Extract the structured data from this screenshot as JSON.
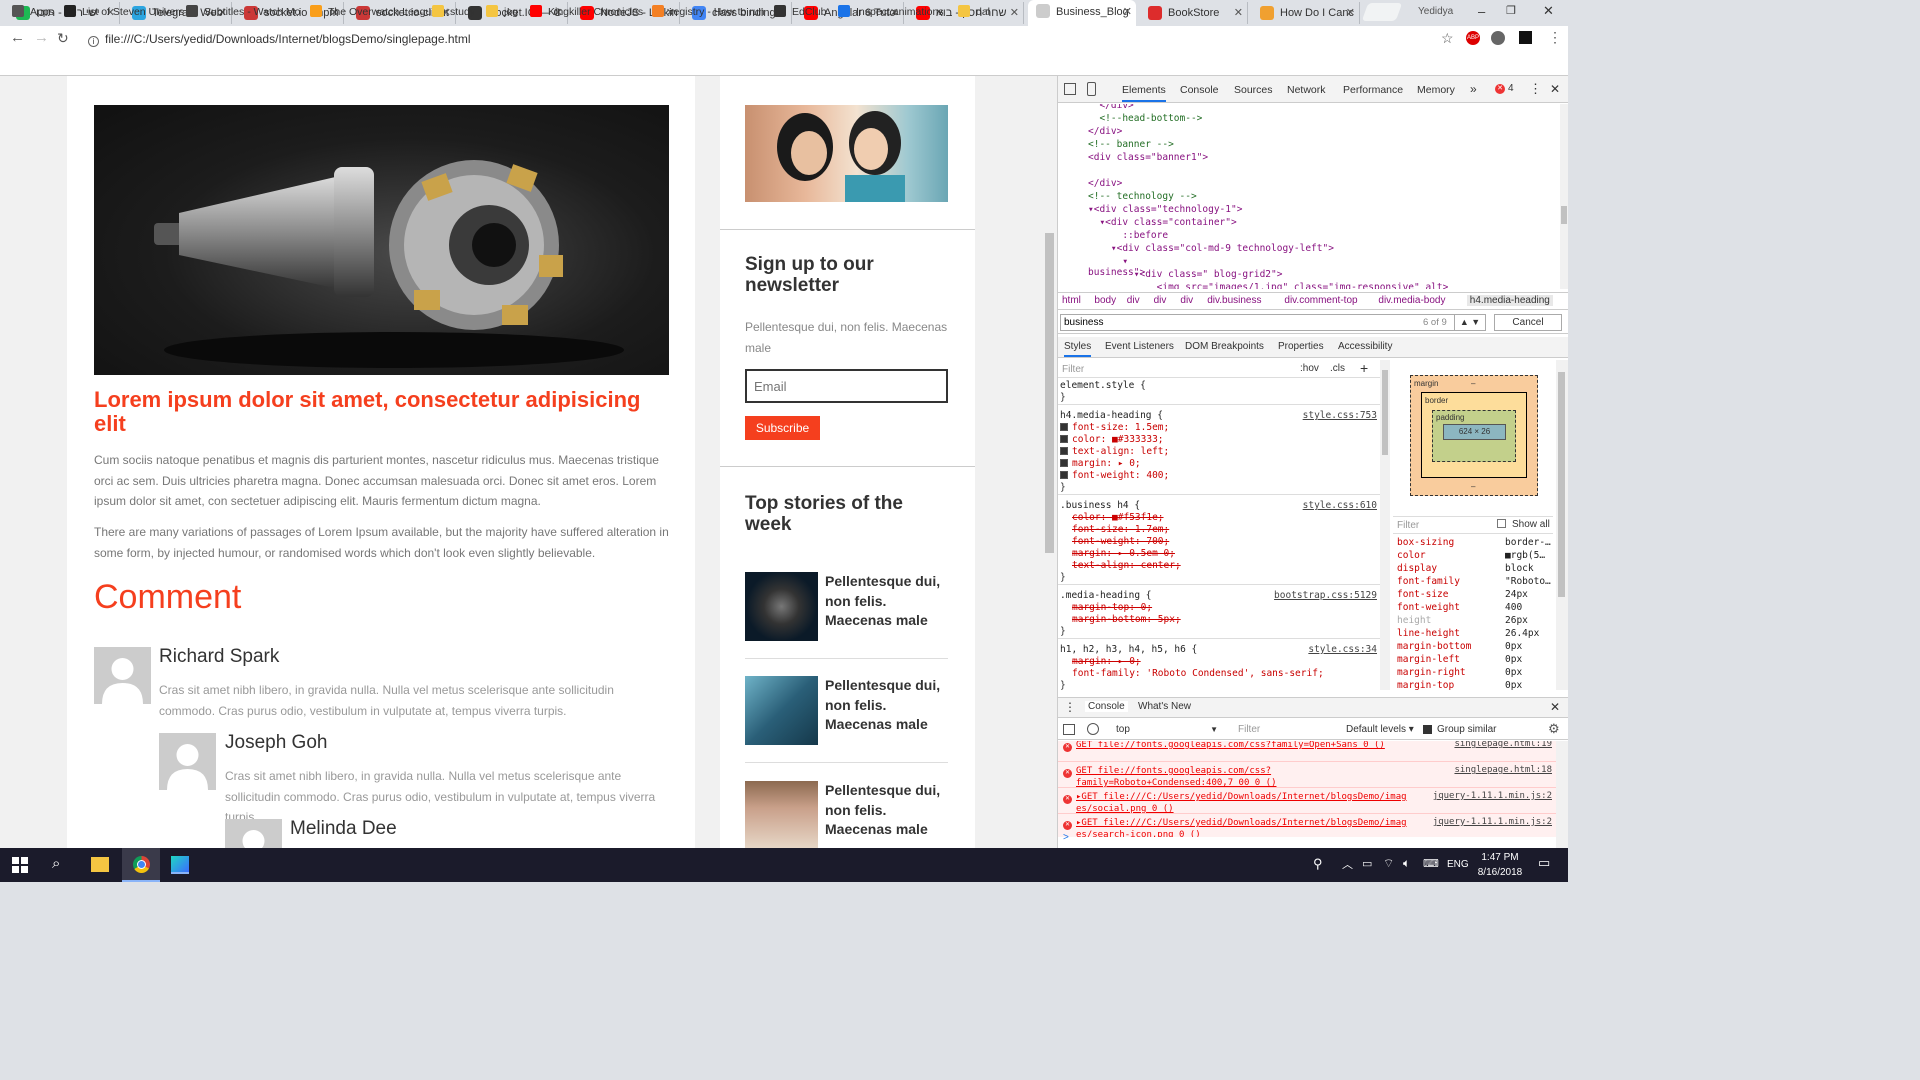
{
  "tabs": [
    {
      "label": "ישי ריבו - תוכו",
      "fav": "#1db954"
    },
    {
      "label": "Telegram Web",
      "fav": "#2ca5e0"
    },
    {
      "label": "socket.io - npm",
      "fav": "#cb3837"
    },
    {
      "label": "socket.io-client",
      "fav": "#cb3837"
    },
    {
      "label": "Socket.IO — C",
      "fav": "#333"
    },
    {
      "label": "NodeJS - Linkin",
      "fav": "#ff0000"
    },
    {
      "label": "class binding a",
      "fav": "#4285f4"
    },
    {
      "label": "Angular 6 Tuto",
      "fav": "#ff0000"
    },
    {
      "label": "שחר חסון - בוא",
      "fav": "#ff0000"
    },
    {
      "label": "Business_Blog",
      "fav": "#ccc"
    },
    {
      "label": "BookStore",
      "fav": "#dd2c2c"
    },
    {
      "label": "How Do I Canc",
      "fav": "#f0a030"
    }
  ],
  "window": {
    "user": "Yedidya"
  },
  "omnibox": {
    "url": "file:///C:/Users/yedid/Downloads/Internet/blogsDemo/singlepage.html",
    "info_icon": "info-icon"
  },
  "bookmarks": [
    {
      "label": "Apps",
      "color": "#555"
    },
    {
      "label": "List of Steven Univers",
      "color": "#222"
    },
    {
      "label": "Subtitles - Watch Mo",
      "color": "#444"
    },
    {
      "label": "The Overwatch Leagu",
      "color": "#f99e1a"
    },
    {
      "label": "study",
      "color": "#f4c542"
    },
    {
      "label": "jog",
      "color": "#f4c542"
    },
    {
      "label": "Kingkiller Chronicles",
      "color": "#ff0000"
    },
    {
      "label": "registry - How to run",
      "color": "#f48024"
    },
    {
      "label": "EdClub",
      "color": "#333"
    },
    {
      "label": "Inspect animations",
      "color": "#1a73e8"
    },
    {
      "label": "dal",
      "color": "#f4c542"
    }
  ],
  "article": {
    "title": "Lorem ipsum dolor sit amet, consectetur adipisicing elit",
    "p1": "Cum sociis natoque penatibus et magnis dis parturient montes, nascetur ridiculus mus. Maecenas tristique orci ac sem. Duis ultricies pharetra magna. Donec accumsan malesuada orci. Donec sit amet eros. Lorem ipsum dolor sit amet, con sectetuer adipiscing elit. Mauris fermentum dictum magna.",
    "p2": "There are many variations of passages of Lorem Ipsum available, but the majority have suffered alteration in some form, by injected humour, or randomised words which don't look even slightly believable.",
    "comment_heading": "Comment",
    "comments": [
      {
        "name": "Richard Spark",
        "text": "Cras sit amet nibh libero, in gravida nulla. Nulla vel metus scelerisque ante sollicitudin commodo. Cras purus odio, vestibulum in vulputate at, tempus viverra turpis."
      },
      {
        "name": "Joseph Goh",
        "text": "Cras sit amet nibh libero, in gravida nulla. Nulla vel metus scelerisque ante sollicitudin commodo. Cras purus odio, vestibulum in vulputate at, tempus viverra turpis."
      },
      {
        "name": "Melinda Dee",
        "text": ""
      }
    ]
  },
  "sidebar": {
    "newsletter_title": "Sign up to our newsletter",
    "newsletter_text": "Pellentesque dui, non felis. Maecenas male",
    "email_placeholder": "Email",
    "subscribe": "Subscribe",
    "top_title": "Top stories of the week",
    "stories": [
      {
        "text": "Pellentesque dui, non felis. Maecenas male"
      },
      {
        "text": "Pellentesque dui, non felis. Maecenas male"
      },
      {
        "text": "Pellentesque dui, non felis. Maecenas male"
      }
    ]
  },
  "devtools": {
    "tabs": [
      "Elements",
      "Console",
      "Sources",
      "Network",
      "Performance",
      "Memory"
    ],
    "more_tabs": "»",
    "errors": "4",
    "dom": [
      "  </div>",
      "  <!--head-bottom-->",
      "</div>",
      "<!-- banner -->",
      "<div class=\"banner1\">",
      "",
      "</div>",
      "<!-- technology -->",
      "▾<div class=\"technology-1\">",
      "  ▾<div class=\"container\">",
      "      ::before",
      "    ▾<div class=\"col-md-9 technology-left\">",
      "      ▾<div class=\"business\">",
      "        ▾<div class=\" blog-grid2\">",
      "            <img src=\"images/1.jpg\" class=\"img-responsive\" alt>"
    ],
    "breadcrumbs": [
      "html",
      "body",
      "div",
      "div",
      "div",
      "div.business",
      "div.comment-top",
      "div.media-body",
      "h4.media-heading"
    ],
    "search": {
      "value": "business",
      "count": "6 of 9",
      "cancel": "Cancel"
    },
    "subtabs": [
      "Styles",
      "Event Listeners",
      "DOM Breakpoints",
      "Properties",
      "Accessibility"
    ],
    "filter": "Filter",
    "hov": ":hov",
    "cls": ".cls",
    "rules": [
      {
        "selector": "element.style {",
        "source": "",
        "lines": [],
        "close": "}"
      },
      {
        "selector": "h4.media-heading {",
        "source": "style.css:753",
        "lines": [
          {
            "t": "font-size: 1.5em;",
            "s": false
          },
          {
            "t": "color: ■#333333;",
            "s": false
          },
          {
            "t": "text-align: left;",
            "s": false
          },
          {
            "t": "margin: ▸ 0;",
            "s": false
          },
          {
            "t": "font-weight: 400;",
            "s": false
          }
        ],
        "close": "}"
      },
      {
        "selector": ".business h4 {",
        "source": "style.css:610",
        "lines": [
          {
            "t": "color: ■#f53f1e;",
            "s": true
          },
          {
            "t": "font-size: 1.7em;",
            "s": true
          },
          {
            "t": "font-weight: 700;",
            "s": true
          },
          {
            "t": "margin: ▸ 0.5em 0;",
            "s": true
          },
          {
            "t": "text-align: center;",
            "s": true
          }
        ],
        "close": "}"
      },
      {
        "selector": ".media-heading {",
        "source": "bootstrap.css:5129",
        "lines": [
          {
            "t": "margin-top: 0;",
            "s": true
          },
          {
            "t": "margin-bottom: 5px;",
            "s": true
          }
        ],
        "close": "}"
      },
      {
        "selector": "h1, h2, h3, h4, h5, h6 {",
        "source": "style.css:34",
        "lines": [
          {
            "t": "margin: ▸ 0;",
            "s": true
          },
          {
            "t": "font-family: 'Roboto Condensed', sans-serif;",
            "s": false
          }
        ],
        "close": "}"
      }
    ],
    "boxmodel": {
      "margin": "margin",
      "border": "border",
      "padding": "padding",
      "content": "624 × 26",
      "dash": "–"
    },
    "computed_filter": "Filter",
    "show_all": "Show all",
    "computed": [
      {
        "k": "box-sizing",
        "v": "border-…"
      },
      {
        "k": "color",
        "v": "■rgb(5…"
      },
      {
        "k": "display",
        "v": "block"
      },
      {
        "k": "font-family",
        "v": "\"Roboto…"
      },
      {
        "k": "font-size",
        "v": "24px"
      },
      {
        "k": "font-weight",
        "v": "400"
      },
      {
        "k": "height",
        "v": "26px"
      },
      {
        "k": "line-height",
        "v": "26.4px"
      },
      {
        "k": "margin-bottom",
        "v": "0px"
      },
      {
        "k": "margin-left",
        "v": "0px"
      },
      {
        "k": "margin-right",
        "v": "0px"
      },
      {
        "k": "margin-top",
        "v": "0px"
      }
    ],
    "drawer_tabs": [
      "Console",
      "What's New"
    ],
    "console_context": "top",
    "console_filter": "Filter",
    "levels": "Default levels ▾",
    "group_similar": "Group similar",
    "console_lines": [
      {
        "msg": "GET file://fonts.googleapis.com/css?family=Open+Sans 0 ()",
        "src": "singlepage.html:19"
      },
      {
        "msg": "GET file://fonts.googleapis.com/css?family=Roboto+Condensed:400,7 00 0 ()",
        "src": "singlepage.html:18"
      },
      {
        "msg": "▸GET file:///C:/Users/yedid/Downloads/Internet/blogsDemo/imag es/social.png 0 ()",
        "src": "jquery-1.11.1.min.js:2"
      },
      {
        "msg": "▸GET file:///C:/Users/yedid/Downloads/Internet/blogsDemo/imag es/search-icon.png 0 ()",
        "src": "jquery-1.11.1.min.js:2"
      }
    ],
    "prompt": ">"
  },
  "taskbar": {
    "time": "1:47 PM",
    "date": "8/16/2018",
    "lang": "ENG"
  },
  "colors": {
    "accent": "#f53f1e",
    "link": "#1a1aa6"
  }
}
